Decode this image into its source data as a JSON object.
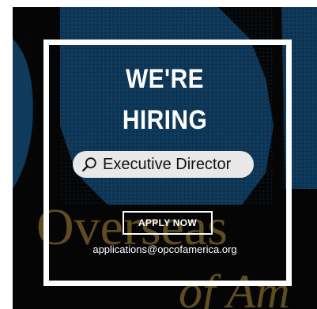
{
  "poster": {
    "headline_line1": "WE'RE",
    "headline_line2": "HIRING",
    "search_role": "Executive Director",
    "search_icon": "search-icon",
    "apply_label": "APPLY NOW",
    "email": "applications@opcofamerica.org",
    "background_text_line1": "Overseas",
    "background_text_line2": "of Am"
  },
  "colors": {
    "background": "#050505",
    "globe_blue": "#0f3a5c",
    "gold_text": "#6f5a26",
    "frame": "#ffffff",
    "pill": "#e8e8e8"
  }
}
